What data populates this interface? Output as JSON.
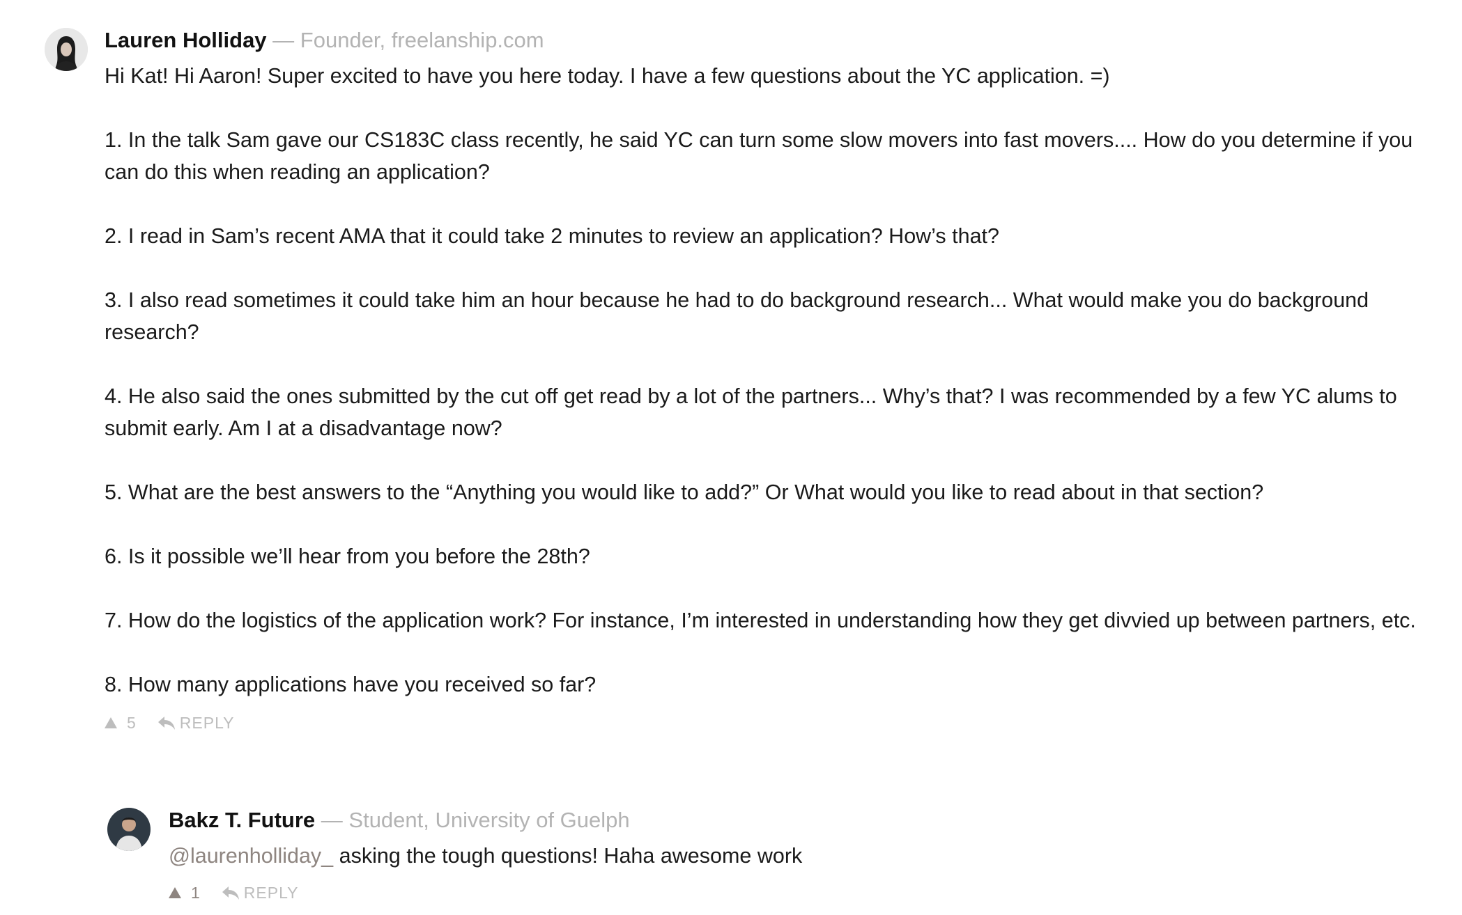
{
  "comments": [
    {
      "author": "Lauren Holliday",
      "separator": "—",
      "title": "Founder, freelanship.com",
      "paragraphs": [
        "Hi Kat! Hi Aaron! Super excited to have you here today. I have a few questions about the YC application. =)",
        "1. In the talk Sam gave our CS183C class recently, he said YC can turn some slow movers into fast movers.... How do you determine if you can do this when reading an application?",
        "2. I read in Sam’s recent AMA that it could take 2 minutes to review an application? How’s that?",
        "3. I also read sometimes it could take him an hour because he had to do background research... What would make you do background research?",
        "4. He also said the ones submitted by the cut off get read by a lot of the partners... Why’s that? I was recommended by a few YC alums to submit early. Am I at a disadvantage now?",
        "5. What are the best answers to the “Anything you would like to add?” Or What would you like to read about in that section?",
        "6. Is it possible we’ll hear from you before the 28th?",
        "7. How do the logistics of the application work? For instance, I’m interested in understanding how they get divvied up between partners, etc.",
        "8. How many applications have you received so far?"
      ],
      "upvotes": "5",
      "reply_label": "REPLY"
    },
    {
      "author": "Bakz T. Future",
      "separator": "—",
      "title": "Student, University of Guelph",
      "mention": "@laurenholliday_",
      "text": " asking the tough questions! Haha awesome work",
      "upvotes": "1",
      "reply_label": "REPLY"
    }
  ],
  "colors": {
    "text": "#1a1a1a",
    "meta": "#b3b3b3",
    "mention": "#8e8580",
    "action": "#bdbdbd"
  },
  "icons": {
    "upvote": "upvote-triangle-icon",
    "reply": "reply-arrow-icon"
  }
}
